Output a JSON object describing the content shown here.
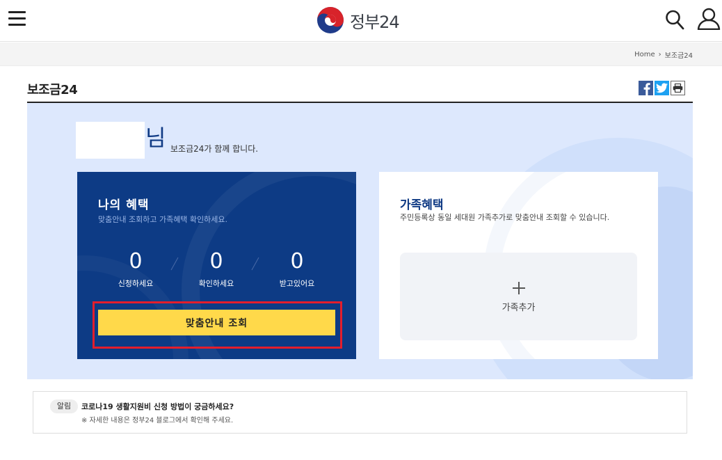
{
  "header": {
    "logo_text": "정부24",
    "menu_icon": "hamburger-menu-icon",
    "search_icon": "search-icon",
    "user_icon": "user-icon"
  },
  "breadcrumb": {
    "home": "Home",
    "separator": "›",
    "current": "보조금24"
  },
  "page": {
    "title": "보조금24"
  },
  "share": {
    "facebook_icon": "facebook-icon",
    "twitter_icon": "twitter-icon",
    "print_icon": "print-icon"
  },
  "greeting": {
    "suffix": "님",
    "message": "보조금24가 함께 합니다."
  },
  "my_benefits": {
    "title": "나의 혜택",
    "subtitle": "맞춤안내 조회하고 가족혜택 확인하세요.",
    "stats": [
      {
        "value": "0",
        "label": "신청하세요"
      },
      {
        "value": "0",
        "label": "확인하세요"
      },
      {
        "value": "0",
        "label": "받고있어요"
      }
    ],
    "cta_label": "맞춤안내 조회"
  },
  "family_benefits": {
    "title": "가족혜택",
    "description": "주민등록상 동일 세대원 가족추가로 맞춤안내 조회할 수 있습니다.",
    "add_label": "가족추가"
  },
  "notice": {
    "badge": "알림",
    "title": "코로나19 생활지원비 신청 방법이 궁금하세요?",
    "subtitle": "※ 자세한 내용은 정부24 블로그에서 확인해 주세요."
  },
  "colors": {
    "primary_navy": "#0d3b85",
    "panel_bg": "#dde8fd",
    "cta_yellow": "#ffd94a",
    "highlight_red": "#e31e2c"
  }
}
